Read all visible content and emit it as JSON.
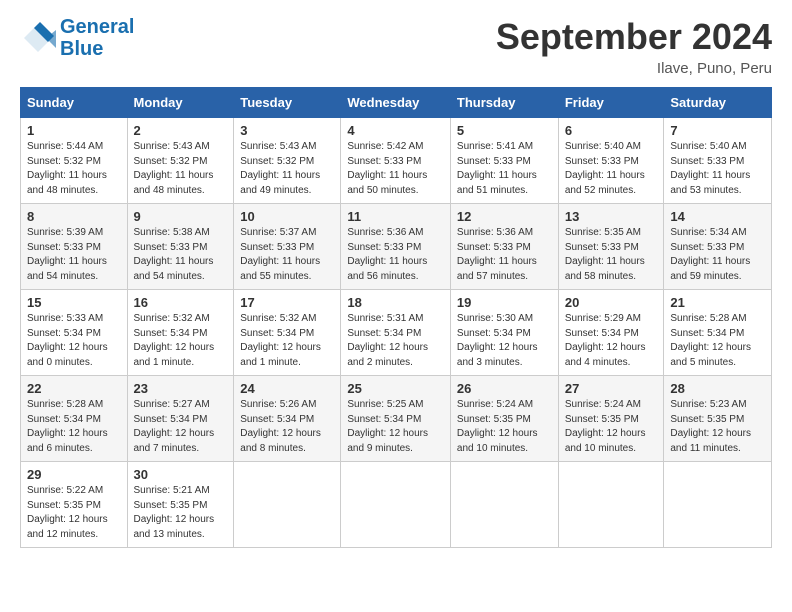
{
  "header": {
    "logo_line1": "General",
    "logo_line2": "Blue",
    "month_year": "September 2024",
    "location": "Ilave, Puno, Peru"
  },
  "weekdays": [
    "Sunday",
    "Monday",
    "Tuesday",
    "Wednesday",
    "Thursday",
    "Friday",
    "Saturday"
  ],
  "weeks": [
    [
      {
        "day": "1",
        "sunrise": "5:44 AM",
        "sunset": "5:32 PM",
        "daylight": "11 hours and 48 minutes."
      },
      {
        "day": "2",
        "sunrise": "5:43 AM",
        "sunset": "5:32 PM",
        "daylight": "11 hours and 48 minutes."
      },
      {
        "day": "3",
        "sunrise": "5:43 AM",
        "sunset": "5:32 PM",
        "daylight": "11 hours and 49 minutes."
      },
      {
        "day": "4",
        "sunrise": "5:42 AM",
        "sunset": "5:33 PM",
        "daylight": "11 hours and 50 minutes."
      },
      {
        "day": "5",
        "sunrise": "5:41 AM",
        "sunset": "5:33 PM",
        "daylight": "11 hours and 51 minutes."
      },
      {
        "day": "6",
        "sunrise": "5:40 AM",
        "sunset": "5:33 PM",
        "daylight": "11 hours and 52 minutes."
      },
      {
        "day": "7",
        "sunrise": "5:40 AM",
        "sunset": "5:33 PM",
        "daylight": "11 hours and 53 minutes."
      }
    ],
    [
      {
        "day": "8",
        "sunrise": "5:39 AM",
        "sunset": "5:33 PM",
        "daylight": "11 hours and 54 minutes."
      },
      {
        "day": "9",
        "sunrise": "5:38 AM",
        "sunset": "5:33 PM",
        "daylight": "11 hours and 54 minutes."
      },
      {
        "day": "10",
        "sunrise": "5:37 AM",
        "sunset": "5:33 PM",
        "daylight": "11 hours and 55 minutes."
      },
      {
        "day": "11",
        "sunrise": "5:36 AM",
        "sunset": "5:33 PM",
        "daylight": "11 hours and 56 minutes."
      },
      {
        "day": "12",
        "sunrise": "5:36 AM",
        "sunset": "5:33 PM",
        "daylight": "11 hours and 57 minutes."
      },
      {
        "day": "13",
        "sunrise": "5:35 AM",
        "sunset": "5:33 PM",
        "daylight": "11 hours and 58 minutes."
      },
      {
        "day": "14",
        "sunrise": "5:34 AM",
        "sunset": "5:33 PM",
        "daylight": "11 hours and 59 minutes."
      }
    ],
    [
      {
        "day": "15",
        "sunrise": "5:33 AM",
        "sunset": "5:34 PM",
        "daylight": "12 hours and 0 minutes."
      },
      {
        "day": "16",
        "sunrise": "5:32 AM",
        "sunset": "5:34 PM",
        "daylight": "12 hours and 1 minute."
      },
      {
        "day": "17",
        "sunrise": "5:32 AM",
        "sunset": "5:34 PM",
        "daylight": "12 hours and 1 minute."
      },
      {
        "day": "18",
        "sunrise": "5:31 AM",
        "sunset": "5:34 PM",
        "daylight": "12 hours and 2 minutes."
      },
      {
        "day": "19",
        "sunrise": "5:30 AM",
        "sunset": "5:34 PM",
        "daylight": "12 hours and 3 minutes."
      },
      {
        "day": "20",
        "sunrise": "5:29 AM",
        "sunset": "5:34 PM",
        "daylight": "12 hours and 4 minutes."
      },
      {
        "day": "21",
        "sunrise": "5:28 AM",
        "sunset": "5:34 PM",
        "daylight": "12 hours and 5 minutes."
      }
    ],
    [
      {
        "day": "22",
        "sunrise": "5:28 AM",
        "sunset": "5:34 PM",
        "daylight": "12 hours and 6 minutes."
      },
      {
        "day": "23",
        "sunrise": "5:27 AM",
        "sunset": "5:34 PM",
        "daylight": "12 hours and 7 minutes."
      },
      {
        "day": "24",
        "sunrise": "5:26 AM",
        "sunset": "5:34 PM",
        "daylight": "12 hours and 8 minutes."
      },
      {
        "day": "25",
        "sunrise": "5:25 AM",
        "sunset": "5:34 PM",
        "daylight": "12 hours and 9 minutes."
      },
      {
        "day": "26",
        "sunrise": "5:24 AM",
        "sunset": "5:35 PM",
        "daylight": "12 hours and 10 minutes."
      },
      {
        "day": "27",
        "sunrise": "5:24 AM",
        "sunset": "5:35 PM",
        "daylight": "12 hours and 10 minutes."
      },
      {
        "day": "28",
        "sunrise": "5:23 AM",
        "sunset": "5:35 PM",
        "daylight": "12 hours and 11 minutes."
      }
    ],
    [
      {
        "day": "29",
        "sunrise": "5:22 AM",
        "sunset": "5:35 PM",
        "daylight": "12 hours and 12 minutes."
      },
      {
        "day": "30",
        "sunrise": "5:21 AM",
        "sunset": "5:35 PM",
        "daylight": "12 hours and 13 minutes."
      },
      null,
      null,
      null,
      null,
      null
    ]
  ]
}
